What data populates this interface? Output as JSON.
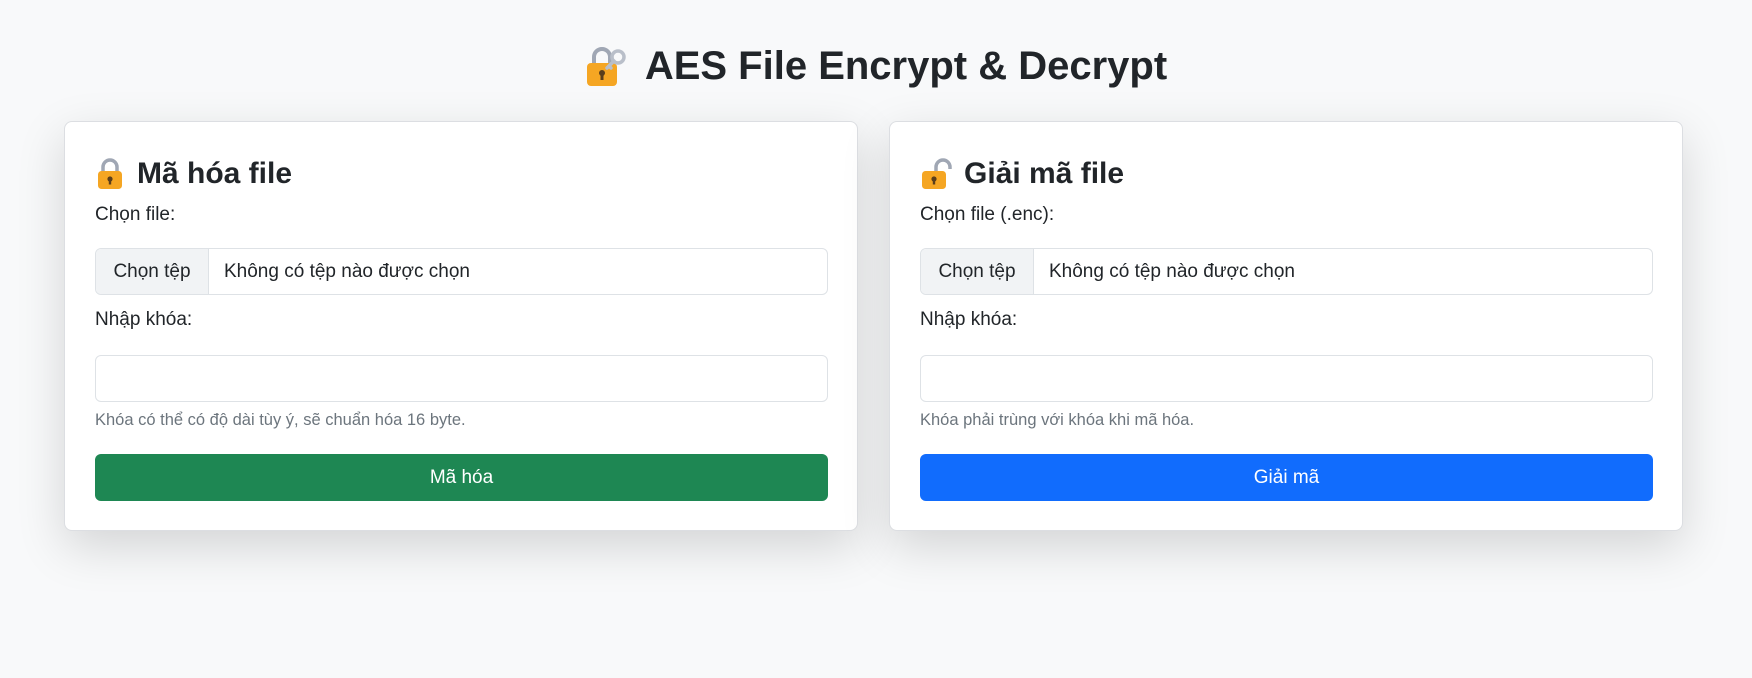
{
  "header": {
    "title": "AES File Encrypt & Decrypt",
    "icon": "lock-with-key-icon"
  },
  "encrypt": {
    "heading": "Mã hóa file",
    "icon": "locked-padlock-icon",
    "file_label": "Chọn file:",
    "file_button": "Chọn tệp",
    "file_status": "Không có tệp nào được chọn",
    "key_label": "Nhập khóa:",
    "key_value": "",
    "help": "Khóa có thể có độ dài tùy ý, sẽ chuẩn hóa 16 byte.",
    "submit": "Mã hóa",
    "submit_color": "#198754"
  },
  "decrypt": {
    "heading": "Giải mã file",
    "icon": "unlocked-padlock-icon",
    "file_label": "Chọn file (.enc):",
    "file_button": "Chọn tệp",
    "file_status": "Không có tệp nào được chọn",
    "key_label": "Nhập khóa:",
    "key_value": "",
    "help": "Khóa phải trùng với khóa khi mã hóa.",
    "submit": "Giải mã",
    "submit_color": "#0d6efd"
  }
}
